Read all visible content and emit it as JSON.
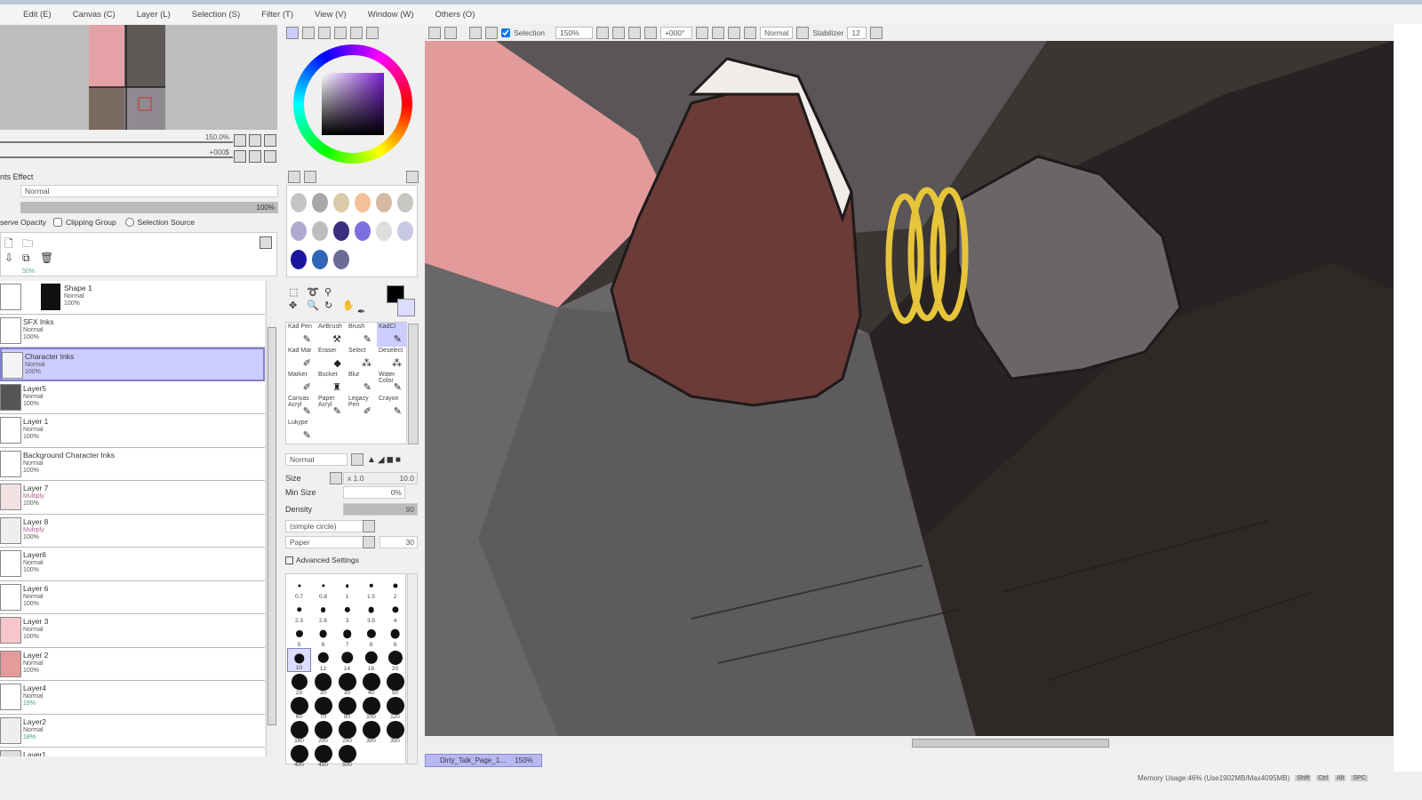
{
  "menu": [
    "Edit (E)",
    "Canvas (C)",
    "Layer (L)",
    "Selection (S)",
    "Filter (T)",
    "View (V)",
    "Window (W)",
    "Others (O)"
  ],
  "toolbar": {
    "selection_label": "Selection",
    "zoom": "150%",
    "rotation": "+000°",
    "blend": "Normal",
    "stabilizer_label": "Stabilizer",
    "stabilizer": "12"
  },
  "navigator": {
    "zoom": "150.0%",
    "angle": "+000$"
  },
  "layer_props": {
    "effect_label": "nts Effect",
    "mode": "Normal",
    "opacity": "100%",
    "preserve_label": "serve Opacity",
    "clipping_label": "Clipping Group",
    "selsource_label": "Selection Source",
    "partial_opacity": "50%"
  },
  "layers": [
    {
      "name": "Shape 1",
      "mode": "Normal",
      "opacity": "100%",
      "thumb": "#111111"
    },
    {
      "name": "SFX Inks",
      "mode": "Normal",
      "opacity": "100%",
      "thumb": "#ffffff"
    },
    {
      "name": "Character Inks",
      "mode": "Normal",
      "opacity": "100%",
      "thumb": "#f4f4f4",
      "selected": true
    },
    {
      "name": "Layer5",
      "mode": "Normal",
      "opacity": "100%",
      "thumb": "#555555"
    },
    {
      "name": "Layer 1",
      "mode": "Normal",
      "opacity": "100%",
      "thumb": "#ffffff"
    },
    {
      "name": "Background Character Inks",
      "mode": "Normal",
      "opacity": "100%",
      "thumb": "#ffffff"
    },
    {
      "name": "Layer 7",
      "mode": "Multiply",
      "opacity": "100%",
      "thumb": "#f3e2e4"
    },
    {
      "name": "Layer 8",
      "mode": "Multiply",
      "opacity": "100%",
      "thumb": "#efeeee"
    },
    {
      "name": "Layer6",
      "mode": "Normal",
      "opacity": "100%",
      "thumb": "#ffffff"
    },
    {
      "name": "Layer 6",
      "mode": "Normal",
      "opacity": "100%",
      "thumb": "#ffffff"
    },
    {
      "name": "Layer 3",
      "mode": "Normal",
      "opacity": "100%",
      "thumb": "#f6c6cc"
    },
    {
      "name": "Layer 2",
      "mode": "Normal",
      "opacity": "100%",
      "thumb": "#e79a9c"
    },
    {
      "name": "Layer4",
      "mode": "Normal",
      "opacity": "15%",
      "thumb": "#ffffff"
    },
    {
      "name": "Layer2",
      "mode": "Normal",
      "opacity": "18%",
      "thumb": "#eeeeee"
    },
    {
      "name": "Layer1",
      "mode": "",
      "opacity": "",
      "thumb": "#dddddd"
    }
  ],
  "palette": [
    "#c4c4c4",
    "#a8a8a8",
    "#d9cba9",
    "#f5c09a",
    "#d6b9a0",
    "#c8c6c2",
    "#aeaacf",
    "#bdbdbd",
    "#3a2f80",
    "#7d6ee0",
    "#dedede",
    "#c8c8e4",
    "#1d15a0",
    "#2f66b8",
    "#6c6a96"
  ],
  "tools": [
    {
      "label": "Kad Pen",
      "icon": "✎"
    },
    {
      "label": "AirBrush",
      "icon": "⚒"
    },
    {
      "label": "Brush",
      "icon": "✎"
    },
    {
      "label": "KadCl",
      "icon": "✎",
      "selected": true
    },
    {
      "label": "Kad Mar",
      "icon": "✐"
    },
    {
      "label": "Eraser",
      "icon": "◆"
    },
    {
      "label": "Select",
      "icon": "⁂"
    },
    {
      "label": "Deselect",
      "icon": "⁂"
    },
    {
      "label": "Marker",
      "icon": "✐"
    },
    {
      "label": "Bucket",
      "icon": "♜"
    },
    {
      "label": "Blur",
      "icon": "✎"
    },
    {
      "label": "Water Color",
      "icon": "✎"
    },
    {
      "label": "Canvas Acryl",
      "icon": "✎"
    },
    {
      "label": "Paper Acryl",
      "icon": "✎"
    },
    {
      "label": "Legacy Pen",
      "icon": "✐"
    },
    {
      "label": "Crayon",
      "icon": "✎"
    },
    {
      "label": "Lukype",
      "icon": "✎"
    }
  ],
  "brush": {
    "mode": "Normal",
    "size_label": "Size",
    "size_mult": "x 1.0",
    "size": "10.0",
    "minsize_label": "Min Size",
    "minsize": "0%",
    "density_label": "Density",
    "density": "90",
    "shape": "(simple circle)",
    "texture": "Paper",
    "texture_val": "30",
    "advanced_label": "Advanced Settings"
  },
  "brush_sizes": [
    "0.7",
    "0.8",
    "1",
    "1.5",
    "2",
    "2.3",
    "2.6",
    "3",
    "3.5",
    "4",
    "5",
    "6",
    "7",
    "8",
    "9",
    "10",
    "12",
    "14",
    "16",
    "20",
    "25",
    "30",
    "35",
    "40",
    "50",
    "60",
    "70",
    "80",
    "100",
    "120",
    "160",
    "200",
    "250",
    "300",
    "350",
    "400",
    "450",
    "500"
  ],
  "selected_brush_size": "10",
  "document_tab": {
    "name": "Dirty_Talk_Page_1...",
    "zoom": "150%"
  },
  "status": {
    "memory": "Memory Usage:46% (Use1902MB/Max4095MB)",
    "keys": [
      "Shift",
      "Ctrl",
      "Alt",
      "SPC"
    ]
  }
}
